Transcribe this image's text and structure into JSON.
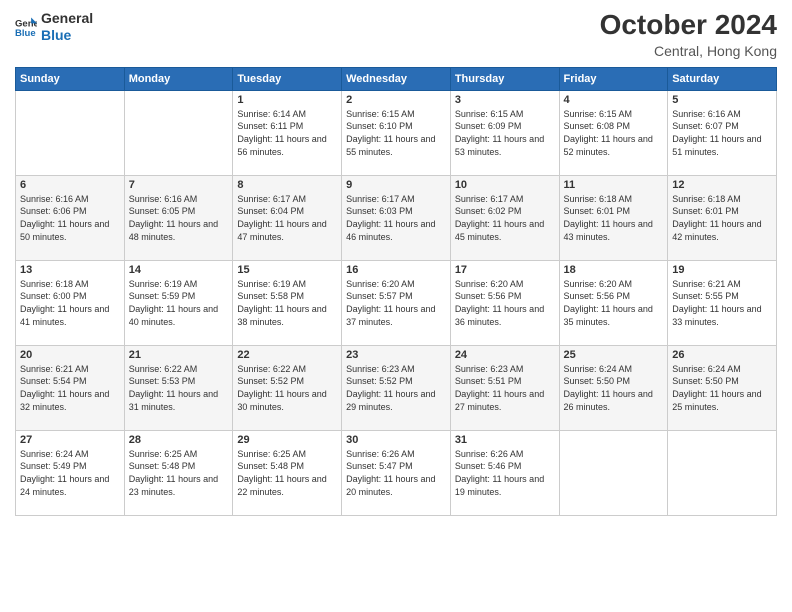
{
  "logo": {
    "general": "General",
    "blue": "Blue"
  },
  "title": "October 2024",
  "location": "Central, Hong Kong",
  "days_of_week": [
    "Sunday",
    "Monday",
    "Tuesday",
    "Wednesday",
    "Thursday",
    "Friday",
    "Saturday"
  ],
  "weeks": [
    [
      {
        "day": "",
        "sunrise": "",
        "sunset": "",
        "daylight": ""
      },
      {
        "day": "",
        "sunrise": "",
        "sunset": "",
        "daylight": ""
      },
      {
        "day": "1",
        "sunrise": "Sunrise: 6:14 AM",
        "sunset": "Sunset: 6:11 PM",
        "daylight": "Daylight: 11 hours and 56 minutes."
      },
      {
        "day": "2",
        "sunrise": "Sunrise: 6:15 AM",
        "sunset": "Sunset: 6:10 PM",
        "daylight": "Daylight: 11 hours and 55 minutes."
      },
      {
        "day": "3",
        "sunrise": "Sunrise: 6:15 AM",
        "sunset": "Sunset: 6:09 PM",
        "daylight": "Daylight: 11 hours and 53 minutes."
      },
      {
        "day": "4",
        "sunrise": "Sunrise: 6:15 AM",
        "sunset": "Sunset: 6:08 PM",
        "daylight": "Daylight: 11 hours and 52 minutes."
      },
      {
        "day": "5",
        "sunrise": "Sunrise: 6:16 AM",
        "sunset": "Sunset: 6:07 PM",
        "daylight": "Daylight: 11 hours and 51 minutes."
      }
    ],
    [
      {
        "day": "6",
        "sunrise": "Sunrise: 6:16 AM",
        "sunset": "Sunset: 6:06 PM",
        "daylight": "Daylight: 11 hours and 50 minutes."
      },
      {
        "day": "7",
        "sunrise": "Sunrise: 6:16 AM",
        "sunset": "Sunset: 6:05 PM",
        "daylight": "Daylight: 11 hours and 48 minutes."
      },
      {
        "day": "8",
        "sunrise": "Sunrise: 6:17 AM",
        "sunset": "Sunset: 6:04 PM",
        "daylight": "Daylight: 11 hours and 47 minutes."
      },
      {
        "day": "9",
        "sunrise": "Sunrise: 6:17 AM",
        "sunset": "Sunset: 6:03 PM",
        "daylight": "Daylight: 11 hours and 46 minutes."
      },
      {
        "day": "10",
        "sunrise": "Sunrise: 6:17 AM",
        "sunset": "Sunset: 6:02 PM",
        "daylight": "Daylight: 11 hours and 45 minutes."
      },
      {
        "day": "11",
        "sunrise": "Sunrise: 6:18 AM",
        "sunset": "Sunset: 6:01 PM",
        "daylight": "Daylight: 11 hours and 43 minutes."
      },
      {
        "day": "12",
        "sunrise": "Sunrise: 6:18 AM",
        "sunset": "Sunset: 6:01 PM",
        "daylight": "Daylight: 11 hours and 42 minutes."
      }
    ],
    [
      {
        "day": "13",
        "sunrise": "Sunrise: 6:18 AM",
        "sunset": "Sunset: 6:00 PM",
        "daylight": "Daylight: 11 hours and 41 minutes."
      },
      {
        "day": "14",
        "sunrise": "Sunrise: 6:19 AM",
        "sunset": "Sunset: 5:59 PM",
        "daylight": "Daylight: 11 hours and 40 minutes."
      },
      {
        "day": "15",
        "sunrise": "Sunrise: 6:19 AM",
        "sunset": "Sunset: 5:58 PM",
        "daylight": "Daylight: 11 hours and 38 minutes."
      },
      {
        "day": "16",
        "sunrise": "Sunrise: 6:20 AM",
        "sunset": "Sunset: 5:57 PM",
        "daylight": "Daylight: 11 hours and 37 minutes."
      },
      {
        "day": "17",
        "sunrise": "Sunrise: 6:20 AM",
        "sunset": "Sunset: 5:56 PM",
        "daylight": "Daylight: 11 hours and 36 minutes."
      },
      {
        "day": "18",
        "sunrise": "Sunrise: 6:20 AM",
        "sunset": "Sunset: 5:56 PM",
        "daylight": "Daylight: 11 hours and 35 minutes."
      },
      {
        "day": "19",
        "sunrise": "Sunrise: 6:21 AM",
        "sunset": "Sunset: 5:55 PM",
        "daylight": "Daylight: 11 hours and 33 minutes."
      }
    ],
    [
      {
        "day": "20",
        "sunrise": "Sunrise: 6:21 AM",
        "sunset": "Sunset: 5:54 PM",
        "daylight": "Daylight: 11 hours and 32 minutes."
      },
      {
        "day": "21",
        "sunrise": "Sunrise: 6:22 AM",
        "sunset": "Sunset: 5:53 PM",
        "daylight": "Daylight: 11 hours and 31 minutes."
      },
      {
        "day": "22",
        "sunrise": "Sunrise: 6:22 AM",
        "sunset": "Sunset: 5:52 PM",
        "daylight": "Daylight: 11 hours and 30 minutes."
      },
      {
        "day": "23",
        "sunrise": "Sunrise: 6:23 AM",
        "sunset": "Sunset: 5:52 PM",
        "daylight": "Daylight: 11 hours and 29 minutes."
      },
      {
        "day": "24",
        "sunrise": "Sunrise: 6:23 AM",
        "sunset": "Sunset: 5:51 PM",
        "daylight": "Daylight: 11 hours and 27 minutes."
      },
      {
        "day": "25",
        "sunrise": "Sunrise: 6:24 AM",
        "sunset": "Sunset: 5:50 PM",
        "daylight": "Daylight: 11 hours and 26 minutes."
      },
      {
        "day": "26",
        "sunrise": "Sunrise: 6:24 AM",
        "sunset": "Sunset: 5:50 PM",
        "daylight": "Daylight: 11 hours and 25 minutes."
      }
    ],
    [
      {
        "day": "27",
        "sunrise": "Sunrise: 6:24 AM",
        "sunset": "Sunset: 5:49 PM",
        "daylight": "Daylight: 11 hours and 24 minutes."
      },
      {
        "day": "28",
        "sunrise": "Sunrise: 6:25 AM",
        "sunset": "Sunset: 5:48 PM",
        "daylight": "Daylight: 11 hours and 23 minutes."
      },
      {
        "day": "29",
        "sunrise": "Sunrise: 6:25 AM",
        "sunset": "Sunset: 5:48 PM",
        "daylight": "Daylight: 11 hours and 22 minutes."
      },
      {
        "day": "30",
        "sunrise": "Sunrise: 6:26 AM",
        "sunset": "Sunset: 5:47 PM",
        "daylight": "Daylight: 11 hours and 20 minutes."
      },
      {
        "day": "31",
        "sunrise": "Sunrise: 6:26 AM",
        "sunset": "Sunset: 5:46 PM",
        "daylight": "Daylight: 11 hours and 19 minutes."
      },
      {
        "day": "",
        "sunrise": "",
        "sunset": "",
        "daylight": ""
      },
      {
        "day": "",
        "sunrise": "",
        "sunset": "",
        "daylight": ""
      }
    ]
  ]
}
